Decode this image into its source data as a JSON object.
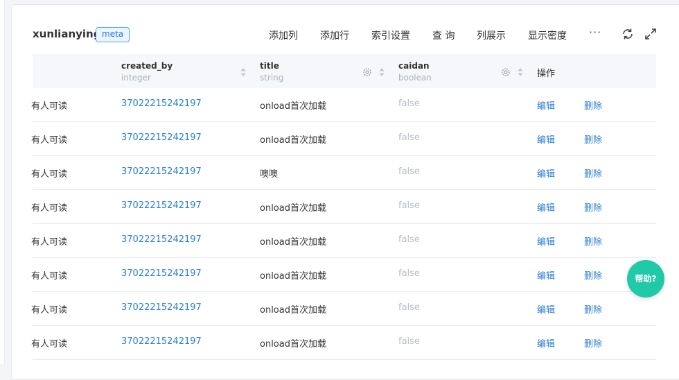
{
  "header": {
    "title": "xunlianying",
    "badge": "meta",
    "toolbar": [
      "添加列",
      "添加行",
      "索引设置",
      "查 询",
      "列展示",
      "显示密度"
    ],
    "more": "···"
  },
  "table": {
    "columns": [
      {
        "name": "created_by",
        "type": "integer"
      },
      {
        "name": "title",
        "type": "string"
      },
      {
        "name": "caidan",
        "type": "boolean"
      },
      {
        "name": "操作"
      }
    ],
    "rows": [
      {
        "access": "有人可读",
        "created_by": "37022215242197",
        "title": "onload首次加载",
        "caidan": "false",
        "edit": "编辑",
        "delete": "删除"
      },
      {
        "access": "有人可读",
        "created_by": "37022215242197",
        "title": "onload首次加载",
        "caidan": "false",
        "edit": "编辑",
        "delete": "删除"
      },
      {
        "access": "有人可读",
        "created_by": "37022215242197",
        "title": "噢噢",
        "caidan": "false",
        "edit": "编辑",
        "delete": "删除"
      },
      {
        "access": "有人可读",
        "created_by": "37022215242197",
        "title": "onload首次加载",
        "caidan": "false",
        "edit": "编辑",
        "delete": "删除"
      },
      {
        "access": "有人可读",
        "created_by": "37022215242197",
        "title": "onload首次加载",
        "caidan": "false",
        "edit": "编辑",
        "delete": "删除"
      },
      {
        "access": "有人可读",
        "created_by": "37022215242197",
        "title": "onload首次加载",
        "caidan": "false",
        "edit": "编辑",
        "delete": "删除"
      },
      {
        "access": "有人可读",
        "created_by": "37022215242197",
        "title": "onload首次加载",
        "caidan": "false",
        "edit": "编辑",
        "delete": "删除"
      },
      {
        "access": "有人可读",
        "created_by": "37022215242197",
        "title": "onload首次加载",
        "caidan": "false",
        "edit": "编辑",
        "delete": "删除"
      }
    ]
  },
  "help": "帮助?",
  "colors": {
    "accent": "#2a7fd2",
    "help": "#20c9a8",
    "header_bg": "#f5f7fa"
  }
}
